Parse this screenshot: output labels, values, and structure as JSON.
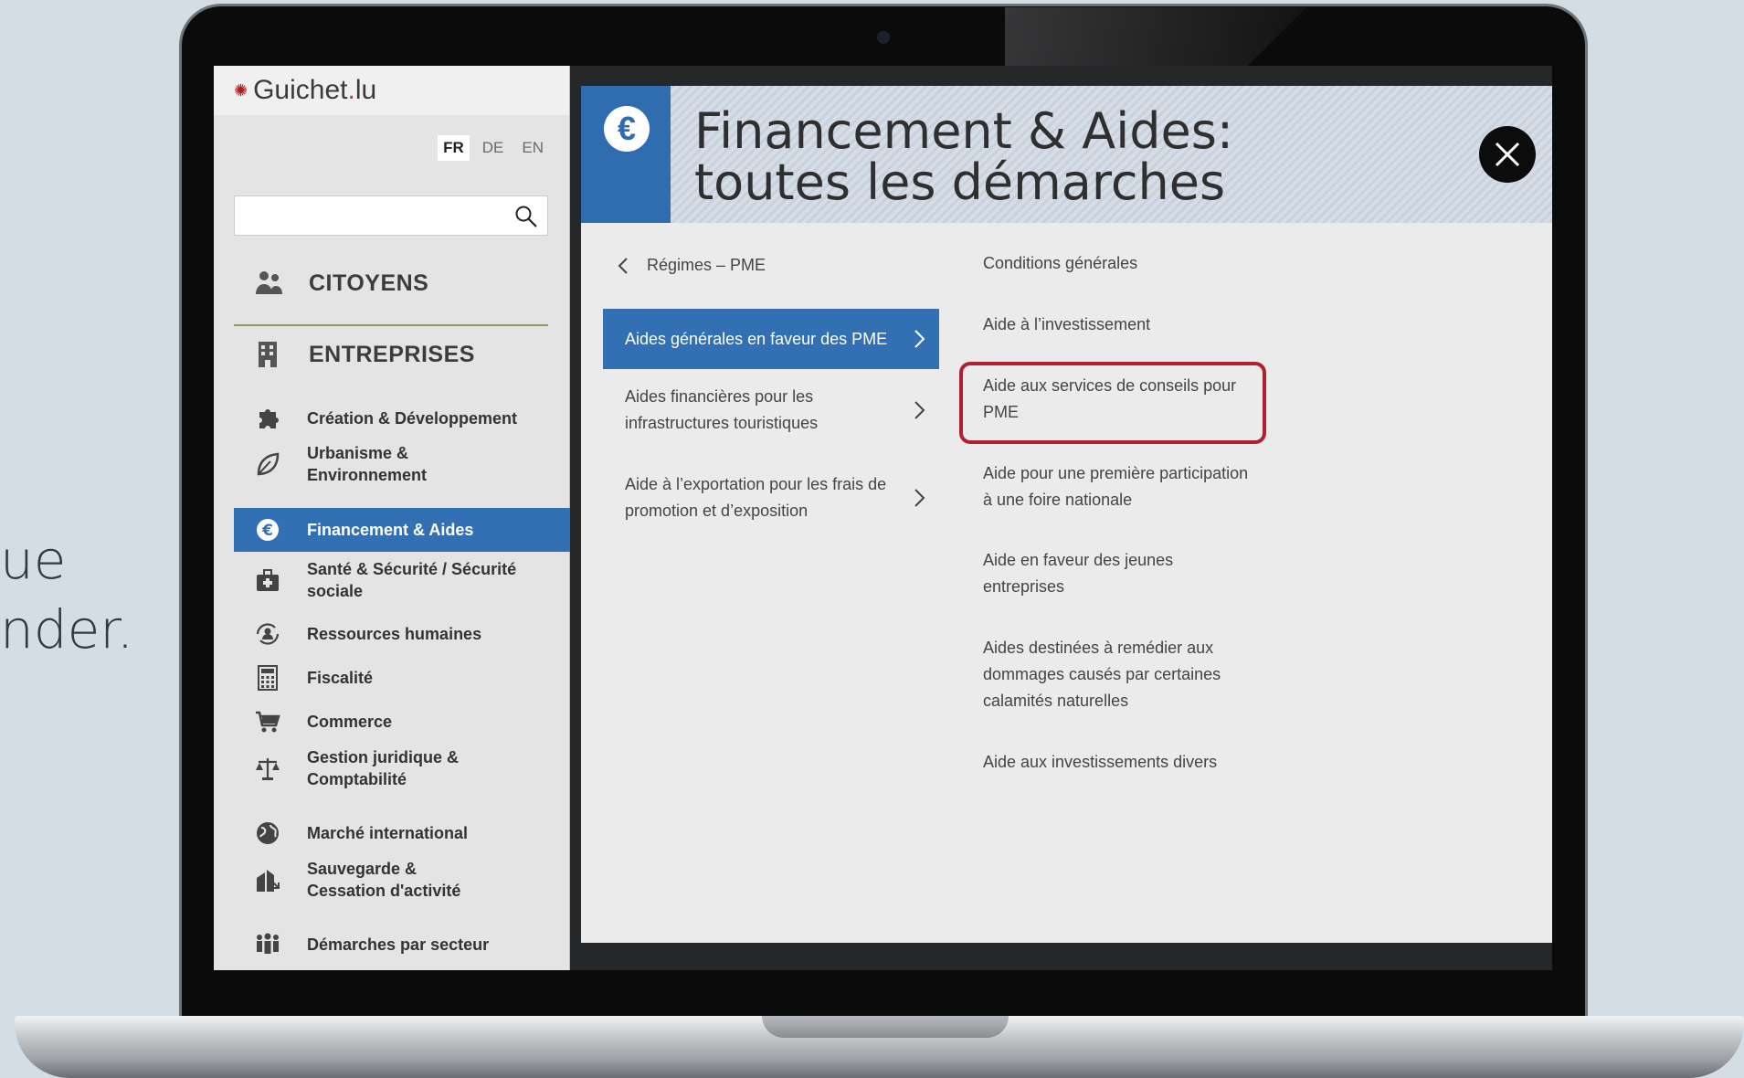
{
  "background_text": [
    "ue",
    "nder."
  ],
  "sidebar": {
    "logo": {
      "prefix": "Guichet",
      "dot": ".",
      "suffix": "lu"
    },
    "languages": [
      {
        "label": "FR",
        "active": true
      },
      {
        "label": "DE",
        "active": false
      },
      {
        "label": "EN",
        "active": false
      }
    ],
    "search": {
      "placeholder": ""
    },
    "sections": {
      "citoyens": "CITOYENS",
      "entreprises": "ENTREPRISES"
    },
    "items": [
      {
        "label": "Création & Développement",
        "icon": "puzzle-icon"
      },
      {
        "label": "Urbanisme & Environnement",
        "icon": "leaf-icon"
      },
      {
        "label": "Financement & Aides",
        "icon": "euro-icon",
        "active": true
      },
      {
        "label": "Santé & Sécurité / Sécurité sociale",
        "icon": "medkit-icon"
      },
      {
        "label": "Ressources humaines",
        "icon": "people-cycle-icon"
      },
      {
        "label": "Fiscalité",
        "icon": "calculator-icon"
      },
      {
        "label": "Commerce",
        "icon": "cart-icon"
      },
      {
        "label": "Gestion juridique & Comptabilité",
        "icon": "scales-icon"
      },
      {
        "label": "Marché international",
        "icon": "globe-icon"
      },
      {
        "label": "Sauvegarde & Cessation d'activité",
        "icon": "building-down-icon"
      },
      {
        "label": "Démarches par secteur",
        "icon": "group-icon"
      }
    ]
  },
  "panel": {
    "title": "Financement & Aides: toutes les démarches",
    "back_label": "Régimes – PME",
    "subcategories": [
      {
        "label": "Aides générales en faveur des PME",
        "active": true
      },
      {
        "label": "Aides financières pour les infrastructures touristiques",
        "active": false
      },
      {
        "label": "Aide à l’exportation pour les frais de promotion et d’exposition",
        "active": false
      }
    ],
    "links": [
      "Conditions générales",
      "Aide à l’investissement",
      "Aide aux services de conseils pour PME",
      "Aide pour une première participation à une foire nationale",
      "Aide en faveur des jeunes entreprises",
      "Aides destinées à remédier aux dommages causés par certaines calamités naturelles",
      "Aide aux investissements divers"
    ],
    "highlighted_link_index": 2
  },
  "colors": {
    "accent_blue": "#3270b3",
    "highlight_red": "#b02030",
    "sidebar_bg": "#e4e4e4",
    "panel_bg": "#ebebeb"
  }
}
